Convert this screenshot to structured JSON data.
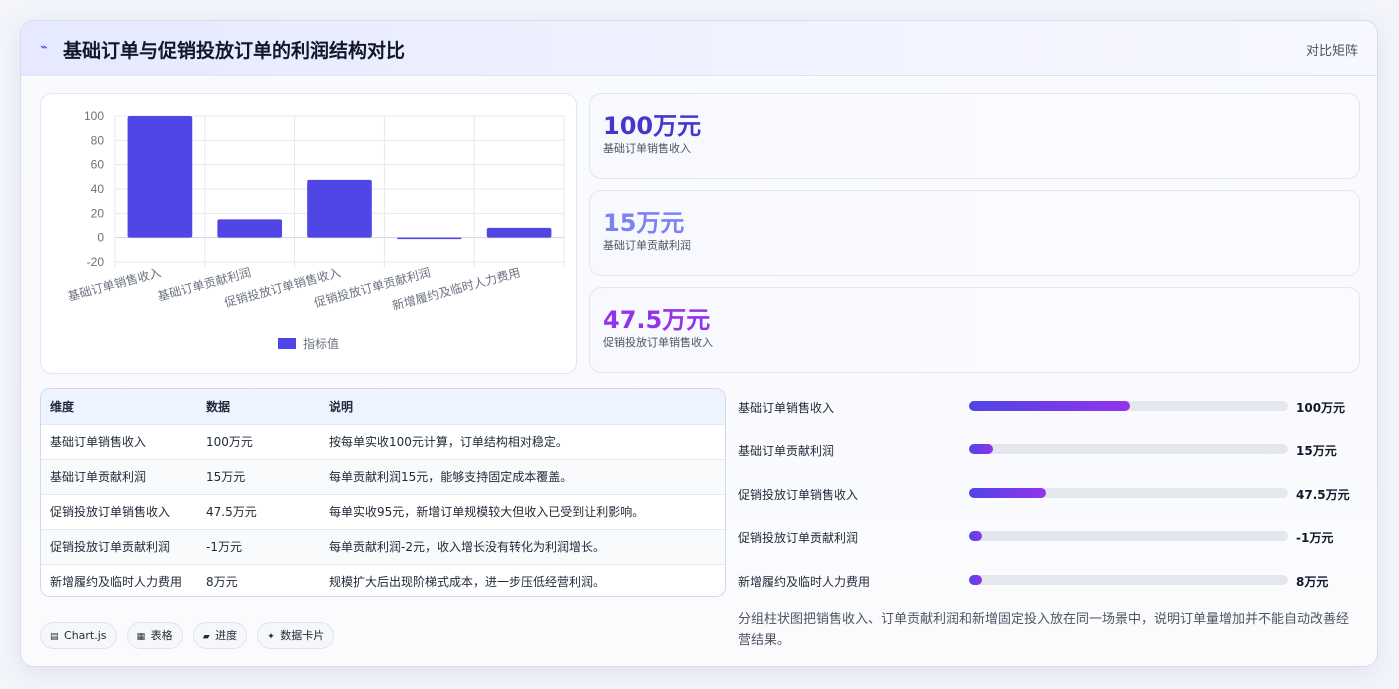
{
  "header": {
    "icon": "wave-icon",
    "title": "基础订单与促销投放订单的利润结构对比",
    "right_label": "对比矩阵"
  },
  "chart_data": {
    "type": "bar",
    "categories": [
      "基础订单销售收入",
      "基础订单贡献利润",
      "促销投放订单销售收入",
      "促销投放订单贡献利润",
      "新增履约及临时人力费用"
    ],
    "series": [
      {
        "name": "指标值",
        "values": [
          100,
          15,
          47.5,
          -1,
          8
        ]
      }
    ],
    "ylim": [
      -20,
      100
    ],
    "yticks": [
      "100",
      "80",
      "60",
      "40",
      "20",
      "0",
      "-20"
    ],
    "legend": "bottom",
    "color": "#4f46e5"
  },
  "stats": [
    {
      "value": "100万元",
      "label": "基础订单销售收入",
      "color": "#4338ca"
    },
    {
      "value": "15万元",
      "label": "基础订单贡献利润",
      "color": "#7c83f0"
    },
    {
      "value": "47.5万元",
      "label": "促销投放订单销售收入",
      "color": "#9333ea"
    }
  ],
  "table": {
    "headers": [
      "维度",
      "数据",
      "说明"
    ],
    "rows": [
      [
        "基础订单销售收入",
        "100万元",
        "按每单实收100元计算，订单结构相对稳定。"
      ],
      [
        "基础订单贡献利润",
        "15万元",
        "每单贡献利润15元，能够支持固定成本覆盖。"
      ],
      [
        "促销投放订单销售收入",
        "47.5万元",
        "每单实收95元，新增订单规模较大但收入已受到让利影响。"
      ],
      [
        "促销投放订单贡献利润",
        "-1万元",
        "每单贡献利润-2元，收入增长没有转化为利润增长。"
      ],
      [
        "新增履约及临时人力费用",
        "8万元",
        "规模扩大后出现阶梯式成本，进一步压低经营利润。"
      ]
    ]
  },
  "progress": [
    {
      "name": "基础订单销售收入",
      "value": "100万元",
      "fraction": 0.505
    },
    {
      "name": "基础订单贡献利润",
      "value": "15万元",
      "fraction": 0.075
    },
    {
      "name": "促销投放订单销售收入",
      "value": "47.5万元",
      "fraction": 0.24
    },
    {
      "name": "促销投放订单贡献利润",
      "value": "-1万元",
      "fraction": 0.04
    },
    {
      "name": "新增履约及临时人力费用",
      "value": "8万元",
      "fraction": 0.04
    }
  ],
  "summary": "分组柱状图把销售收入、订单贡献利润和新增固定投入放在同一场景中，说明订单量增加并不能自动改善经营结果。",
  "tags": [
    {
      "icon": "chart-icon",
      "glyph": "▤",
      "label": "Chart.js"
    },
    {
      "icon": "table-icon",
      "glyph": "▦",
      "label": "表格"
    },
    {
      "icon": "progress-icon",
      "glyph": "▰",
      "label": "进度"
    },
    {
      "icon": "sparkle-icon",
      "glyph": "✦",
      "label": "数据卡片"
    }
  ]
}
